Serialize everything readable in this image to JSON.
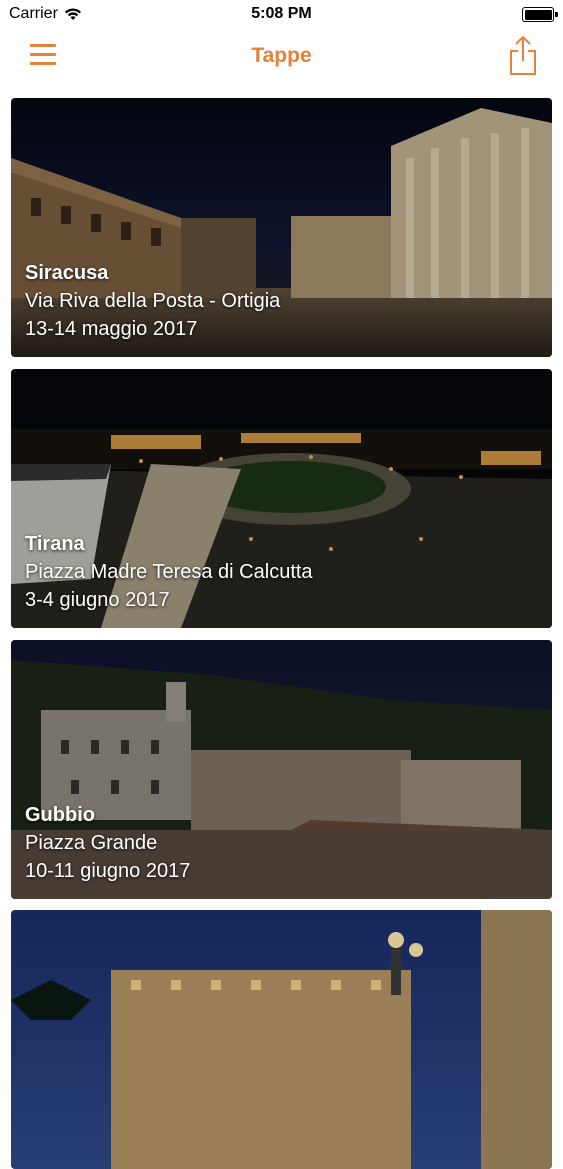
{
  "status_bar": {
    "carrier": "Carrier",
    "time": "5:08 PM",
    "battery_level": 1.0
  },
  "nav": {
    "title": "Tappe",
    "menu_icon": "hamburger-menu-icon",
    "share_icon": "share-icon",
    "accent_color": "#e6813a"
  },
  "stages": [
    {
      "city": "Siracusa",
      "place": "Via Riva della Posta - Ortigia",
      "date": "13-14 maggio 2017"
    },
    {
      "city": "Tirana",
      "place": "Piazza Madre Teresa di Calcutta",
      "date": "3-4 giugno 2017"
    },
    {
      "city": "Gubbio",
      "place": "Piazza Grande",
      "date": "10-11 giugno 2017"
    },
    {
      "city": "",
      "place": "",
      "date": ""
    }
  ]
}
